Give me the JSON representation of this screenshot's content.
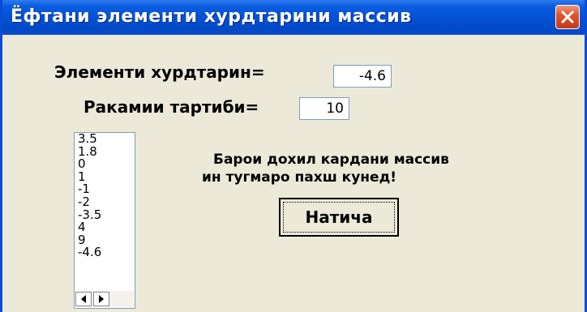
{
  "window": {
    "title": "Ёфтани элементи хурдтарини массив",
    "accent": "#0a4cd6",
    "close_icon": "close-icon"
  },
  "form": {
    "smallest_label": "Элементи хурдтарин=",
    "smallest_value": "-4.6",
    "index_label": "Ракамии тартиби=",
    "index_value": "10"
  },
  "list": {
    "items": [
      "3.5",
      "1.8",
      "0",
      "1",
      "-1",
      "-2",
      "-3.5",
      "4",
      "9",
      "-4.6"
    ],
    "scroll_left_icon": "arrow-left-icon",
    "scroll_right_icon": "arrow-right-icon"
  },
  "message": {
    "line1": "Барои дохил кардани   массив",
    "line2": "ин тугмаро пахш кунед!"
  },
  "button": {
    "label": "Натича"
  }
}
